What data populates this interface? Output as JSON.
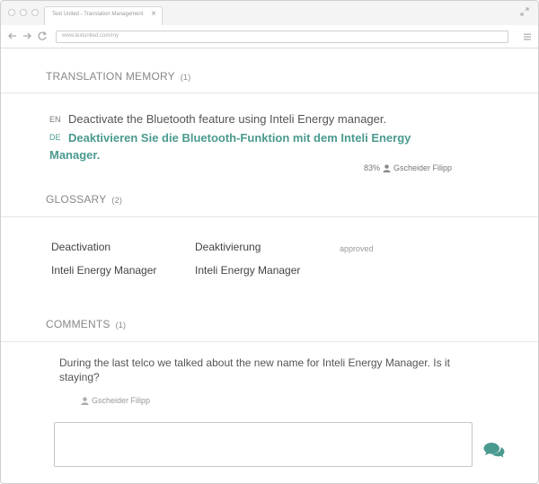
{
  "browser": {
    "tab_title": "Text United - Translation Management",
    "tab_close": "×",
    "url": "www.textunited.com/my"
  },
  "translation_memory": {
    "title": "TRANSLATION MEMORY",
    "count": "(1)",
    "source_lang": "EN",
    "source_text": "Deactivate the Bluetooth feature using Inteli Energy manager.",
    "target_lang": "DE",
    "target_text": "Deaktivieren Sie die Bluetooth-Funktion mit dem Inteli Energy Manager.",
    "match": "83%",
    "author": "Gscheider Filipp"
  },
  "glossary": {
    "title": "GLOSSARY",
    "count": "(2)",
    "rows": [
      {
        "source": "Deactivation",
        "target": "Deaktivierung",
        "status": "approved"
      },
      {
        "source": "Inteli Energy Manager",
        "target": "Inteli Energy Manager",
        "status": ""
      }
    ]
  },
  "comments": {
    "title": "COMMENTS",
    "count": "(1)",
    "items": [
      {
        "text": "During the last telco we talked about the new name for Inteli Energy Manager. Is it staying?",
        "author": "Gscheider Filipp"
      }
    ],
    "input_value": ""
  },
  "colors": {
    "accent": "#4a9a8f",
    "text": "#555555",
    "muted": "#888888"
  },
  "icons": [
    "back-arrow-icon",
    "forward-arrow-icon",
    "reload-icon",
    "menu-icon",
    "expand-icon",
    "user-icon",
    "send-chat-icon"
  ]
}
